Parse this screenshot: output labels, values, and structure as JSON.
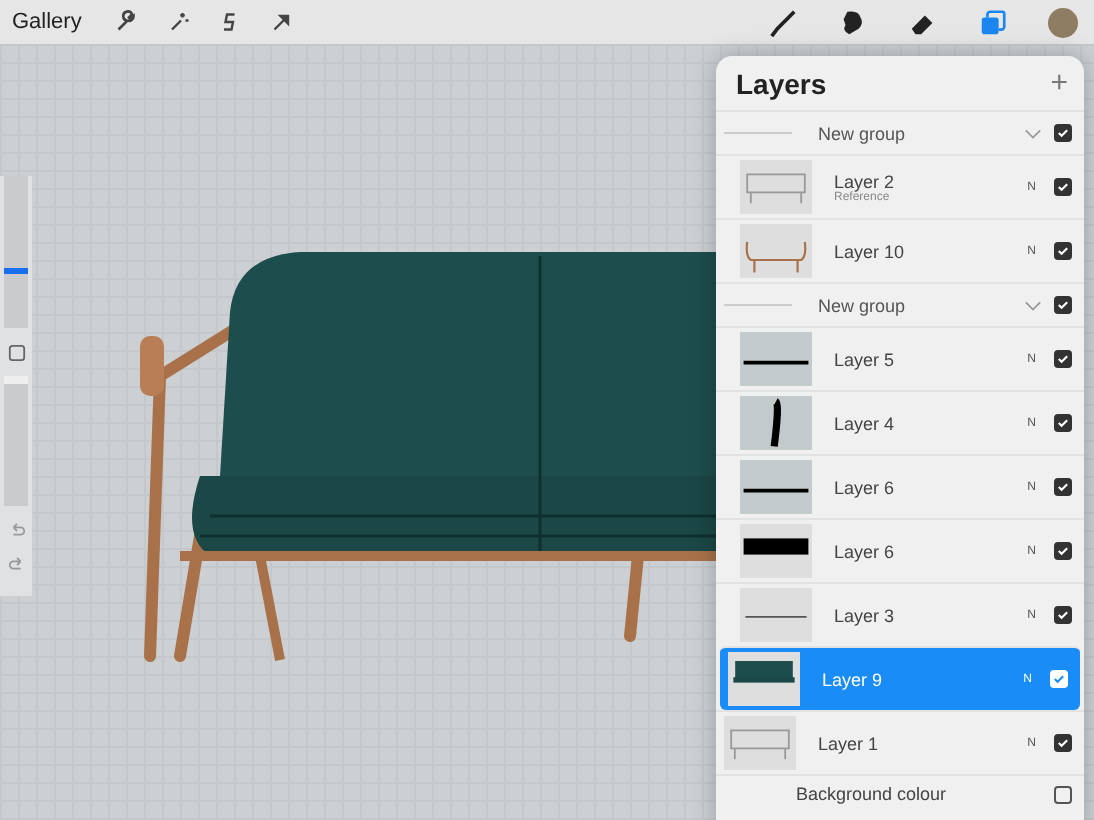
{
  "toolbar": {
    "gallery": "Gallery",
    "color": "#8e7d62"
  },
  "sidebar": {
    "brush_size": {
      "level": 0.35
    },
    "opacity": {
      "level": 0.95
    }
  },
  "layers_panel": {
    "title": "Layers",
    "add": "+",
    "items": [
      {
        "kind": "group",
        "name": "New group",
        "expanded": true,
        "visible": true,
        "selected": false,
        "children": [
          {
            "kind": "layer",
            "name": "Layer 2",
            "note": "Reference",
            "blend": "N",
            "visible": true,
            "selected": false
          },
          {
            "kind": "layer",
            "name": "Layer 10",
            "blend": "N",
            "visible": true,
            "selected": false
          }
        ]
      },
      {
        "kind": "group",
        "name": "New group",
        "expanded": true,
        "visible": true,
        "selected": false,
        "children": [
          {
            "kind": "layer",
            "name": "Layer 5",
            "blend": "N",
            "visible": true,
            "selected": false
          },
          {
            "kind": "layer",
            "name": "Layer 4",
            "blend": "N",
            "visible": true,
            "selected": false
          },
          {
            "kind": "layer",
            "name": "Layer 6",
            "blend": "N",
            "visible": true,
            "selected": false
          },
          {
            "kind": "layer",
            "name": "Layer 6",
            "blend": "N",
            "visible": true,
            "selected": false
          },
          {
            "kind": "layer",
            "name": "Layer 3",
            "blend": "N",
            "visible": true,
            "selected": false
          }
        ]
      },
      {
        "kind": "layer",
        "name": "Layer 9",
        "blend": "N",
        "visible": true,
        "selected": true
      },
      {
        "kind": "layer",
        "name": "Layer 1",
        "blend": "N",
        "visible": true,
        "selected": false
      },
      {
        "kind": "background",
        "name": "Background colour",
        "visible": false,
        "selected": false
      }
    ]
  }
}
